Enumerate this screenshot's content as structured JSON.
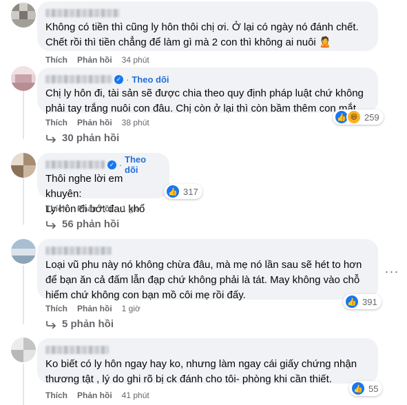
{
  "comments": [
    {
      "text_lines": [
        "Không có tiền thì cũng ly hôn thôi chị ơi. Ở lại có ngày nó đánh chết.",
        "Chết rồi thì tiền chẳng để làm gì mà 2 con thì không ai nuôi 🙎"
      ],
      "like": "Thích",
      "reply": "Phản hồi",
      "time": "34 phút"
    },
    {
      "follow": "Theo dõi",
      "text_lines": [
        "Chị ly hôn đi, tài sản sẽ được chia theo quy định pháp luật chứ không",
        "phải tay trắng nuôi con đâu. Chị còn ở lại thì còn bầm thêm con mắt"
      ],
      "like": "Thích",
      "reply": "Phản hồi",
      "time": "38 phút",
      "reactions": [
        "like-icon",
        "haha-icon"
      ],
      "reaction_count": "259",
      "replies": "30 phản hồi"
    },
    {
      "follow": "Theo dõi",
      "text_lines": [
        "Thôi nghe lời em khuyên:",
        "Ly hôn đi bớt đau khổ"
      ],
      "like": "Thích",
      "reply": "Phản hồi",
      "time": "1 giờ",
      "reactions": [
        "like-icon"
      ],
      "reaction_count": "317",
      "replies": "56 phản hồi"
    },
    {
      "text_lines": [
        "Loại vũ phu này nó không chừa đâu, mà mẹ nó lần sau sẽ hét to hơn",
        "để bạn ăn cả đấm lẫn đạp chứ không phải là tát. May không vào chỗ",
        "hiểm chứ không con bạn mồ côi mẹ rồi đấy."
      ],
      "like": "Thích",
      "reply": "Phản hồi",
      "time": "1 giờ",
      "reactions": [
        "like-icon"
      ],
      "reaction_count": "391",
      "replies": "5 phản hồi",
      "menu": "···"
    },
    {
      "text_lines": [
        "Ko biết có ly hôn ngay hay ko, nhưng làm ngay cái giấy chứng nhận",
        "thương tật , lý do ghi rõ bị ck đánh cho tôi- phòng khi cần thiết."
      ],
      "like": "Thích",
      "reply": "Phản hồi",
      "time": "41 phút",
      "reactions": [
        "like-icon"
      ],
      "reaction_count": "55"
    }
  ],
  "colors": {
    "bubble": "#f0f2f5",
    "muted_text": "#65676b",
    "link_blue": "#216fdb",
    "like_blue": "#1877f2"
  }
}
